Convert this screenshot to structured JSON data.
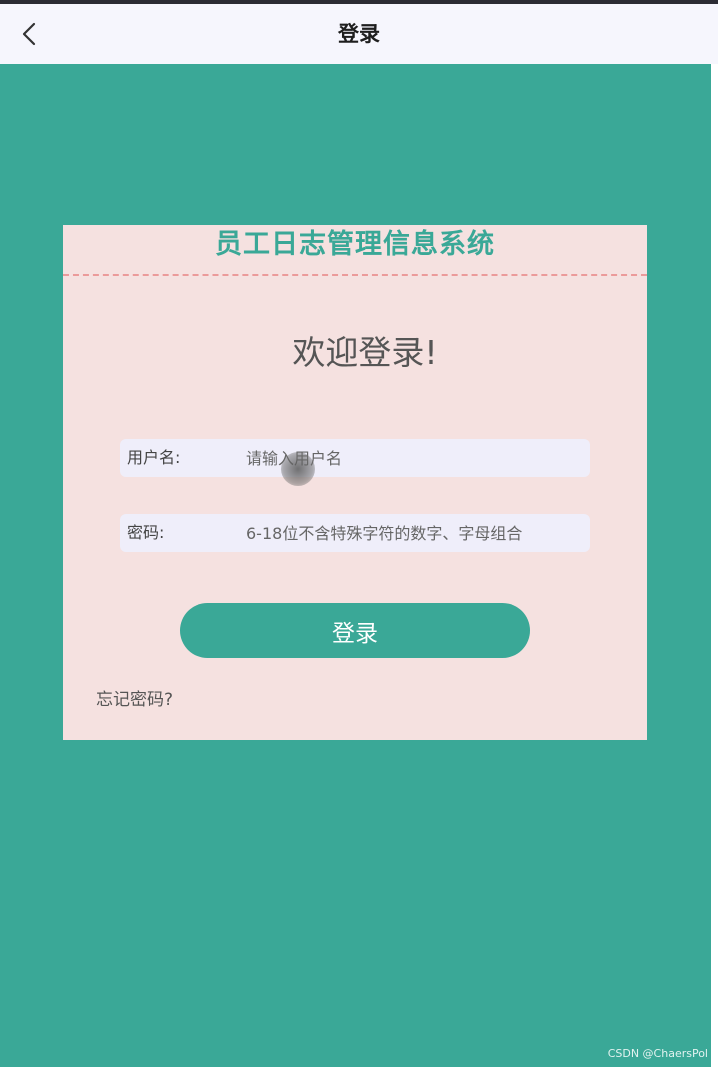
{
  "navbar": {
    "title": "登录",
    "back_icon": "chevron-left-icon"
  },
  "card": {
    "system_title": "员工日志管理信息系统",
    "welcome": "欢迎登录!",
    "username": {
      "label": "用户名:",
      "placeholder": "请输入用户名",
      "value": ""
    },
    "password": {
      "label": "密码:",
      "placeholder": "6-18位不含特殊字符的数字、字母组合",
      "value": ""
    },
    "login_button": "登录",
    "forgot_password": "忘记密码?"
  },
  "watermark": "CSDN @ChaersPol",
  "colors": {
    "accent": "#3aa897",
    "card_bg": "#f5e1e0",
    "divider": "#eb9a9a",
    "field_bg": "#efeefa",
    "navbar_bg": "#f6f6fd"
  }
}
